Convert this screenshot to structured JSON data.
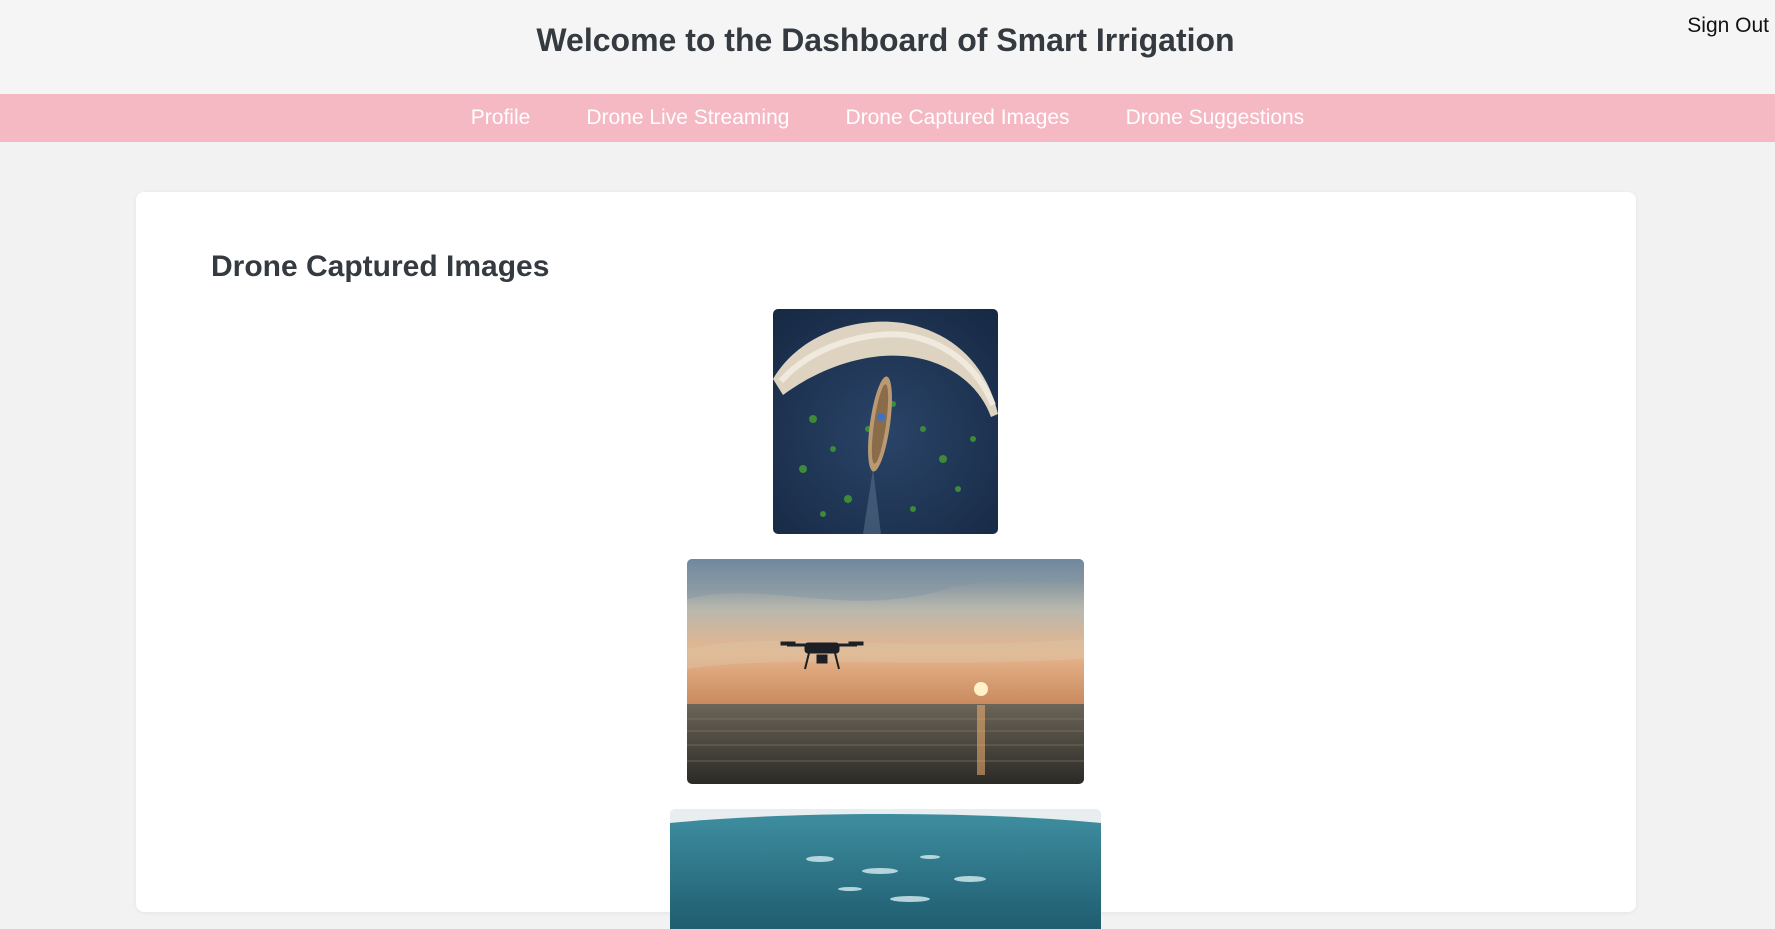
{
  "header": {
    "title": "Welcome to the Dashboard of Smart Irrigation",
    "sign_out_label": "Sign Out"
  },
  "nav": {
    "items": [
      {
        "label": "Profile"
      },
      {
        "label": "Drone Live Streaming"
      },
      {
        "label": "Drone Captured Images"
      },
      {
        "label": "Drone Suggestions"
      }
    ]
  },
  "main": {
    "section_title": "Drone Captured Images",
    "images": [
      {
        "subject": "aerial view of boat leading flock of ducks on water"
      },
      {
        "subject": "drone flying over sea at sunset"
      },
      {
        "subject": "aerial fisheye view of ocean"
      }
    ]
  },
  "colors": {
    "nav_background": "#f4b9c2",
    "header_background": "#f5f5f5",
    "page_background": "#f2f2f2",
    "title_text": "#343a40"
  }
}
